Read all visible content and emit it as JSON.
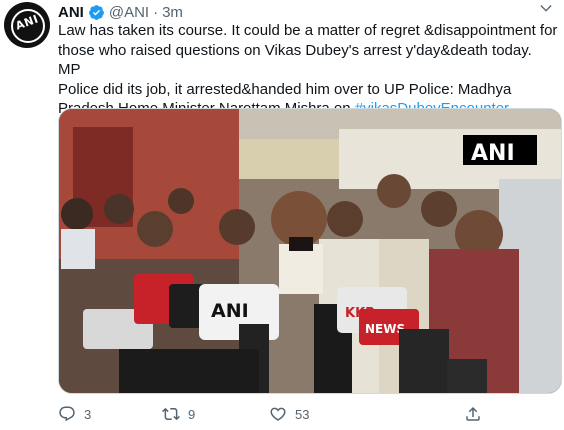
{
  "tweet": {
    "author_name": "ANI",
    "handle": "@ANI",
    "separator": "·",
    "time": "3m",
    "avatar_text": "ANI",
    "text_lines": [
      "Law has taken its course. It could be a matter of regret &disappointment for",
      "those who raised questions on Vikas Dubey's arrest y'day&death today. MP",
      "Police did its job, it arrested&handed him over to UP Police: Madhya",
      "Pradesh Home Minister Narottam Mishra on "
    ],
    "hashtag": "#vikasDubeyEncounter",
    "media": {
      "watermark": "ANI",
      "mic_label_ani": "ANI",
      "mic_label_news": "NEWS",
      "mic_label_kkr": "KKR"
    },
    "actions": {
      "reply_count": "3",
      "retweet_count": "9",
      "like_count": "53"
    }
  },
  "colors": {
    "accent": "#1d9bf0",
    "text": "#0f1419",
    "muted": "#536471"
  }
}
